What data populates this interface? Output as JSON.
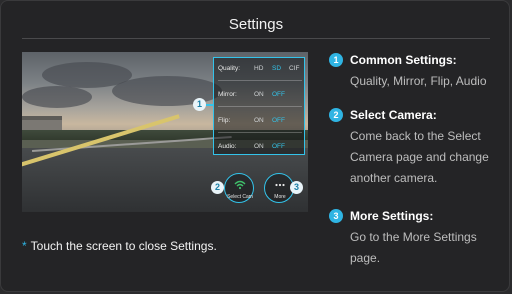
{
  "window": {
    "title": "Settings"
  },
  "preview": {
    "overlay": {
      "rows": [
        {
          "label": "Quality:",
          "options": [
            "HD",
            "SD",
            "CIF"
          ],
          "selected": "SD"
        },
        {
          "label": "Mirror:",
          "options": [
            "ON",
            "OFF"
          ],
          "selected": "OFF"
        },
        {
          "label": "Flip:",
          "options": [
            "ON",
            "OFF"
          ],
          "selected": "OFF"
        },
        {
          "label": "Audio:",
          "options": [
            "ON",
            "OFF"
          ],
          "selected": "OFF"
        }
      ],
      "select_camera_label": "Select Cam",
      "more_label": "More"
    },
    "badges": [
      "1",
      "2",
      "3"
    ]
  },
  "help": [
    {
      "num": "1",
      "heading": "Common Settings:",
      "lines": [
        "Quality, Mirror, Flip, Audio"
      ]
    },
    {
      "num": "2",
      "heading": "Select Camera:",
      "lines": [
        "Come back to the Select",
        "Camera page and change",
        "another camera."
      ]
    },
    {
      "num": "3",
      "heading": "More Settings:",
      "lines": [
        "Go to  the More Settings",
        "page."
      ]
    }
  ],
  "note": {
    "star": "*",
    "text": "Touch the screen to close Settings."
  },
  "colors": {
    "accent": "#2fb4e3",
    "background": "#242426",
    "text_secondary": "#bdbdbd"
  }
}
